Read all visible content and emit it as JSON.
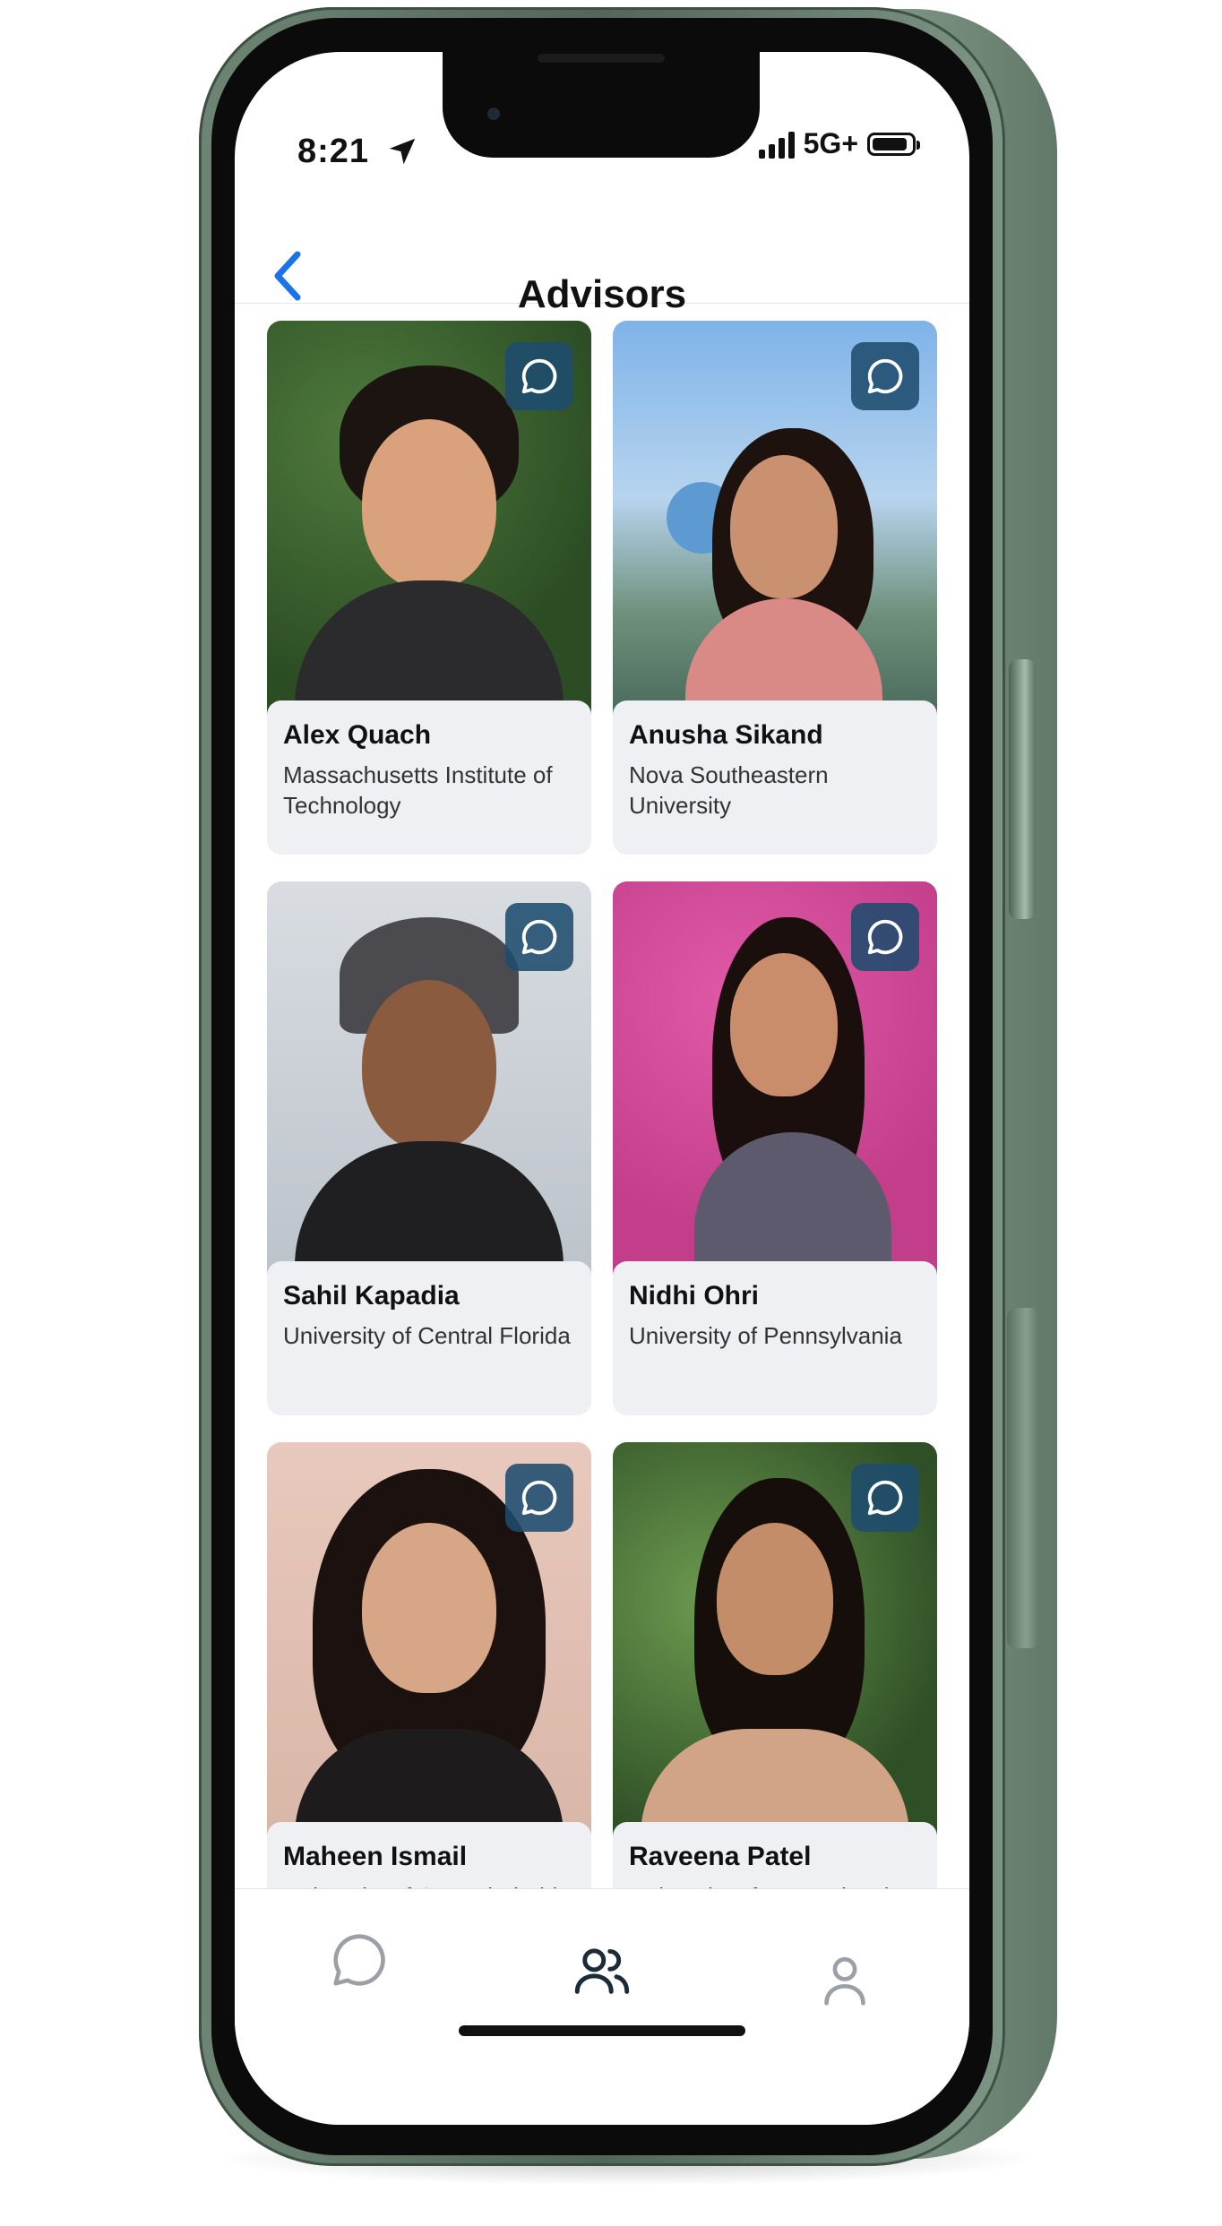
{
  "status_bar": {
    "time": "8:21",
    "network": "5G+"
  },
  "nav": {
    "title": "Advisors"
  },
  "advisors": [
    {
      "name": "Alex Quach",
      "school": "Massachusetts Institute of Technology"
    },
    {
      "name": "Anusha Sikand",
      "school": "Nova Southeastern University"
    },
    {
      "name": "Sahil Kapadia",
      "school": "University of Central Florida"
    },
    {
      "name": "Nidhi Ohri",
      "school": "University of Pennsylvania"
    },
    {
      "name": "Maheen Ismail",
      "school": "University of Central Florida"
    },
    {
      "name": "Raveena Patel",
      "school": "University of Pennsylvania"
    }
  ],
  "icons": {
    "back": "chevron-left-icon",
    "message": "chat-bubble-icon",
    "advisors_tab": "people-icon",
    "profile_tab": "person-icon"
  },
  "colors": {
    "accent": "#1e4c6e",
    "back_link": "#1a73e8",
    "tab_active": "#1c2b36",
    "tab_inactive": "#9aa0a6"
  }
}
